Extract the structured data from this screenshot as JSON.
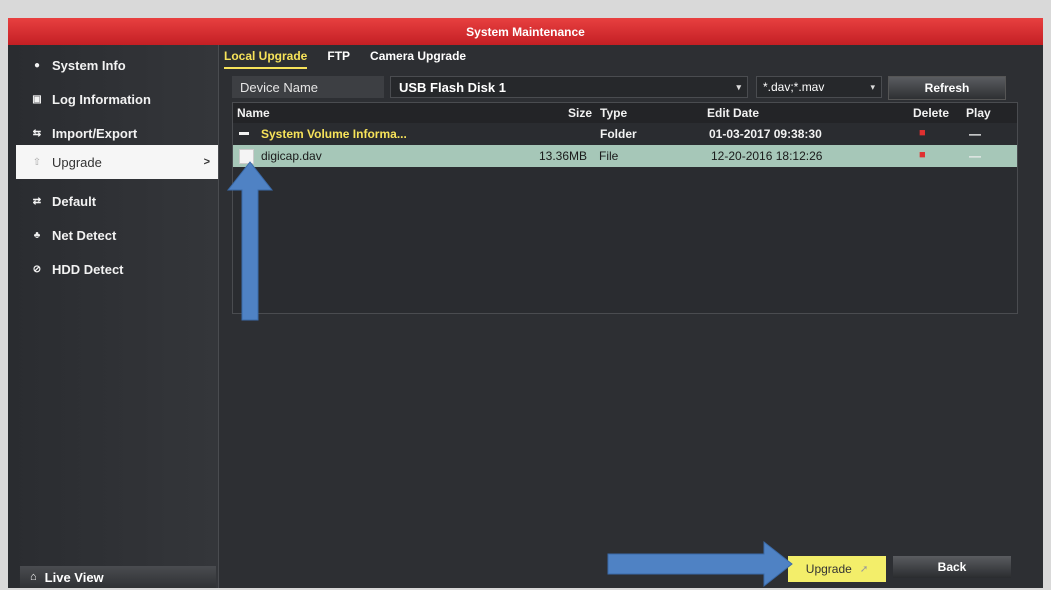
{
  "window": {
    "title": "System Maintenance"
  },
  "sidebar": {
    "items": [
      {
        "label": "System Info",
        "icon": "info-dot-icon"
      },
      {
        "label": "Log Information",
        "icon": "log-icon"
      },
      {
        "label": "Import/Export",
        "icon": "import-export-icon"
      },
      {
        "label": "Upgrade",
        "icon": "upgrade-icon",
        "active": true,
        "chevron": ">"
      },
      {
        "label": "Default",
        "icon": "default-icon"
      },
      {
        "label": "Net Detect",
        "icon": "net-detect-icon"
      },
      {
        "label": "HDD Detect",
        "icon": "hdd-detect-icon"
      }
    ],
    "live_view": "Live View"
  },
  "tabs": [
    {
      "label": "Local Upgrade",
      "active": true
    },
    {
      "label": "FTP"
    },
    {
      "label": "Camera Upgrade"
    }
  ],
  "device": {
    "label": "Device Name",
    "value": "USB Flash Disk 1",
    "filter": "*.dav;*.mav",
    "refresh": "Refresh"
  },
  "table": {
    "headers": {
      "name": "Name",
      "size": "Size",
      "type": "Type",
      "date": "Edit Date",
      "delete": "Delete",
      "play": "Play"
    },
    "rows": [
      {
        "name": "System Volume Informa...",
        "size": "",
        "type": "Folder",
        "date": "01-03-2017 09:38:30",
        "play": "—"
      },
      {
        "name": "digicap.dav",
        "size": "13.36MB",
        "type": "File",
        "date": "12-20-2016 18:12:26",
        "play": "—"
      }
    ]
  },
  "buttons": {
    "upgrade": "Upgrade",
    "back": "Back"
  },
  "colors": {
    "title_red": "#d6282b",
    "highlight_yellow": "#f7e35a",
    "selected_row": "#a6c7b8",
    "annotation_arrow": "#4f82c4"
  }
}
